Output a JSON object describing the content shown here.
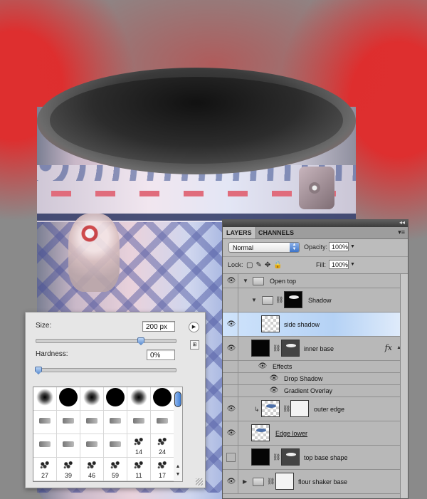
{
  "brush_panel": {
    "size_label": "Size:",
    "size_value": "200 px",
    "size_fraction": 0.75,
    "hardness_label": "Hardness:",
    "hardness_value": "0%",
    "hardness_fraction": 0.0,
    "brush_presets": [
      {
        "kind": "soft"
      },
      {
        "kind": "hard"
      },
      {
        "kind": "soft"
      },
      {
        "kind": "hard"
      },
      {
        "kind": "soft"
      },
      {
        "kind": "hard"
      },
      {
        "kind": "tool"
      },
      {
        "kind": "tool"
      },
      {
        "kind": "tool"
      },
      {
        "kind": "tool"
      },
      {
        "kind": "tool"
      },
      {
        "kind": "tool"
      },
      {
        "kind": "tool"
      },
      {
        "kind": "tool"
      },
      {
        "kind": "tool"
      },
      {
        "kind": "tool"
      },
      {
        "kind": "splat",
        "num": "14"
      },
      {
        "kind": "splat",
        "num": "24"
      },
      {
        "kind": "splat",
        "num": "27"
      },
      {
        "kind": "splat",
        "num": "39"
      },
      {
        "kind": "splat",
        "num": "46"
      },
      {
        "kind": "splat",
        "num": "59"
      },
      {
        "kind": "splat",
        "num": "11"
      },
      {
        "kind": "splat",
        "num": "17"
      }
    ]
  },
  "layers_panel": {
    "tabs": [
      "LAYERS",
      "CHANNELS"
    ],
    "blend_mode": "Normal",
    "opacity_label": "Opacity:",
    "opacity_value": "100%",
    "lock_label": "Lock:",
    "fill_label": "Fill:",
    "fill_value": "100%",
    "layers": [
      {
        "name": "Open top",
        "type": "group",
        "visible": true,
        "indent": 0
      },
      {
        "name": "Shadow",
        "type": "group-mask",
        "visible": false,
        "indent": 1
      },
      {
        "name": "side shadow",
        "type": "layer",
        "visible": true,
        "selected": true
      },
      {
        "name": "inner base",
        "type": "layer-mask",
        "visible": true,
        "fx": "fx"
      },
      {
        "name": "Effects",
        "type": "effects-header",
        "visible": true
      },
      {
        "name": "Drop Shadow",
        "type": "effect",
        "visible": true
      },
      {
        "name": "Gradient Overlay",
        "type": "effect",
        "visible": true
      },
      {
        "name": "outer edge",
        "type": "clipped-mask",
        "visible": true
      },
      {
        "name": "Edge lower",
        "type": "layer-plain",
        "visible": true
      },
      {
        "name": "top base shape",
        "type": "layer-mask-black",
        "visible": false
      },
      {
        "name": "flour shaker base",
        "type": "group-mask",
        "visible": true
      }
    ]
  },
  "colors": {
    "selection": "#b5d2f5",
    "slider_thumb": "#5e8ed0",
    "background_red": "#e22a2a"
  }
}
